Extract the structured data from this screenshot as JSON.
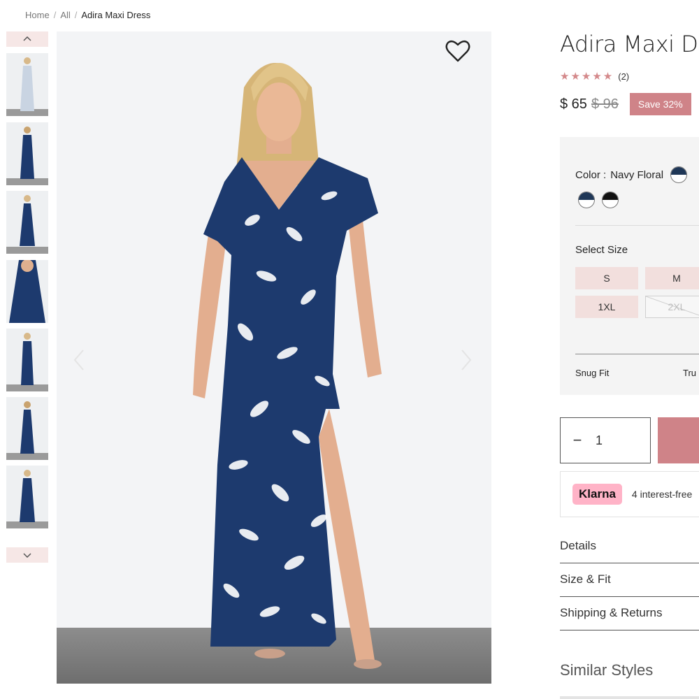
{
  "breadcrumb": {
    "home": "Home",
    "sep": "/",
    "all": "All",
    "current": "Adira Maxi Dress"
  },
  "product": {
    "title": "Adira Maxi Dr",
    "stars": "★★★★★",
    "review_count": "(2)",
    "rating": 5,
    "price": "$ 65",
    "compare_price": "$ 96",
    "save_label": "Save 32%"
  },
  "options": {
    "color_label": "Color :",
    "color_value": "Navy Floral",
    "size_label": "Select Size",
    "sizes": [
      {
        "label": "S",
        "available": true
      },
      {
        "label": "M",
        "available": true
      },
      {
        "label": "1XL",
        "available": true
      },
      {
        "label": "2XL",
        "available": false
      }
    ],
    "fit_left": "Snug Fit",
    "fit_right": "Tru"
  },
  "cart": {
    "quantity": "1"
  },
  "klarna": {
    "logo": "Klarna",
    "text": "4 interest-free"
  },
  "accordion": [
    "Details",
    "Size & Fit",
    "Shipping & Returns"
  ],
  "similar_title": "Similar Styles",
  "colors": {
    "accent": "#cf8388",
    "swatch_navy": "#1f3757",
    "dress_navy": "#1d3a6e",
    "klarna_pink": "#ffb3c7"
  }
}
